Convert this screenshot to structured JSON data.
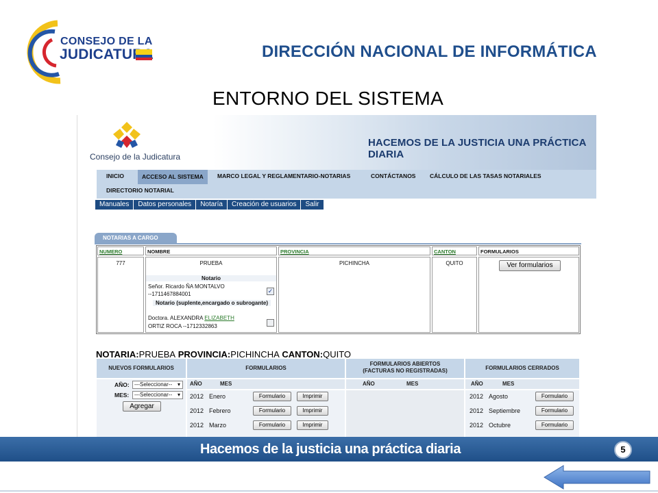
{
  "logo": {
    "line1": "CONSEJO DE LA",
    "line2": "JUDICATURA"
  },
  "header": {
    "department": "DIRECCIÓN NACIONAL DE INFORMÁTICA",
    "subtitle": "ENTORNO DEL SISTEMA"
  },
  "screenshot": {
    "brand": "Consejo de la Judicatura",
    "slogan": "HACEMOS DE LA JUSTICIA UNA PRÁCTICA DIARIA",
    "main_nav": [
      {
        "label": "INICIO",
        "active": false
      },
      {
        "label": "ACCESO AL SISTEMA",
        "active": true
      },
      {
        "label": "MARCO LEGAL Y REGLAMENTARIO-NOTARIAS",
        "active": false
      },
      {
        "label": "CONTÁCTANOS",
        "active": false
      },
      {
        "label": "CÁLCULO DE LAS TASAS NOTARIALES",
        "active": false
      },
      {
        "label": "DIRECTORIO NOTARIAL",
        "active": false
      }
    ],
    "sub_nav": [
      "Manuales",
      "Datos personales",
      "Notaría",
      "Creación de usuarios",
      "Salir"
    ],
    "tab": "NOTARIAS A CARGO",
    "notarias_table": {
      "columns": [
        "NUMERO",
        "NOMBRE",
        "PROVINCIA",
        "CANTON",
        "FORMULARIOS"
      ],
      "row": {
        "numero": "777",
        "nombre": "PRUEBA",
        "notario_header": "Notario",
        "notario_prefix": "Señor. Ricardo ÑA MONTALVO",
        "notario_id": "--1711467884001",
        "notario_checked": true,
        "suplente_header": "Notario (suplente,encargado o subrogante)",
        "suplente_prefix": "Doctora. ALEXANDRA",
        "suplente_link": "ELIZABETH",
        "suplente_rest": "ORTIZ ROCA --1712332863",
        "suplente_checked": false,
        "provincia": "PICHINCHA",
        "canton": "QUITO",
        "button": "Ver formularios"
      }
    },
    "summary": {
      "notaria_label": "NOTARIA:",
      "notaria_value": "PRUEBA",
      "provincia_label": "PROVINCIA:",
      "provincia_value": "PICHINCHA",
      "canton_label": "CANTON:",
      "canton_value": "QUITO"
    },
    "forms": {
      "nuevos_header": "NUEVOS FORMULARIOS",
      "anio_label": "AÑO:",
      "anio_value": "---Seleccionar--",
      "mes_label": "MES:",
      "mes_value": "---Seleccionar--",
      "agregar": "Agregar",
      "formularios_header": "FORMULARIOS",
      "abiertos_header": "FORMULARIOS ABIERTOS (FACTURAS NO REGISTRADAS)",
      "cerrados_header": "FORMULARIOS CERRADOS",
      "col_anio": "AÑO",
      "col_mes": "MES",
      "formulario_btn": "Formulario",
      "imprimir_btn": "Imprimir",
      "formularios": [
        {
          "anio": "2012",
          "mes": "Enero"
        },
        {
          "anio": "2012",
          "mes": "Febrero"
        },
        {
          "anio": "2012",
          "mes": "Marzo"
        }
      ],
      "cerrados": [
        {
          "anio": "2012",
          "mes": "Agosto"
        },
        {
          "anio": "2012",
          "mes": "Septiembre"
        },
        {
          "anio": "2012",
          "mes": "Octubre"
        }
      ]
    }
  },
  "footer": {
    "slogan": "Hacemos de la justicia una práctica diaria",
    "page_number": "5"
  },
  "colors": {
    "brand_blue": "#1f4e8c",
    "footer_blue": "#2a5d99",
    "nav_light": "#c5d6e8",
    "nav_dark": "#1d4b82"
  }
}
